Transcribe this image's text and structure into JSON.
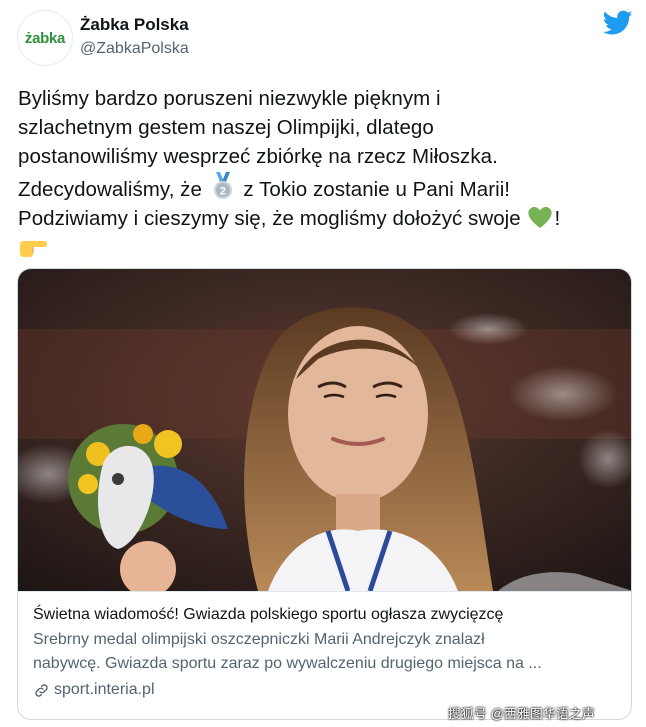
{
  "author": {
    "avatar_logo": "żabka",
    "display_name": "Żabka Polska",
    "handle": "@ZabkaPolska",
    "logo_icon": "twitter-bird-icon"
  },
  "tweet": {
    "line1": "Byliśmy bardzo poruszeni niezwykle pięknym i",
    "line2": "szlachetnym gestem naszej Olimpijki, dlatego",
    "line3": "postanowiliśmy wesprzeć zbiórkę na rzecz Miłoszka.",
    "line4_before": "Zdecydowaliśmy, że ",
    "line4_after": " z Tokio zostanie u Pani Marii!",
    "line5_before": "Podziwiamy i cieszymy się, że mogliśmy dołożyć swoje ",
    "line5_after": "!",
    "emojis": [
      "second-place-medal-icon",
      "green-heart-icon",
      "pointing-right-icon"
    ]
  },
  "card": {
    "title": "Świetna wiadomość! Gwiazda polskiego sportu ogłasza zwycięzcę",
    "desc_line1": "Srebrny medal olimpijski oszczepniczki Marii Andrejczyk znalazł",
    "desc_line2": "nabywcę. Gwiazda sportu zaraz po wywalczeniu drugiego miejsca na ...",
    "domain": "sport.interia.pl"
  },
  "watermark": "搜狐号 @西雅图华语之声",
  "colors": {
    "twitter_blue": "#1d9bf0",
    "zabka_green": "#2f8f3a",
    "text_primary": "#0f1419",
    "text_secondary": "#536471"
  }
}
